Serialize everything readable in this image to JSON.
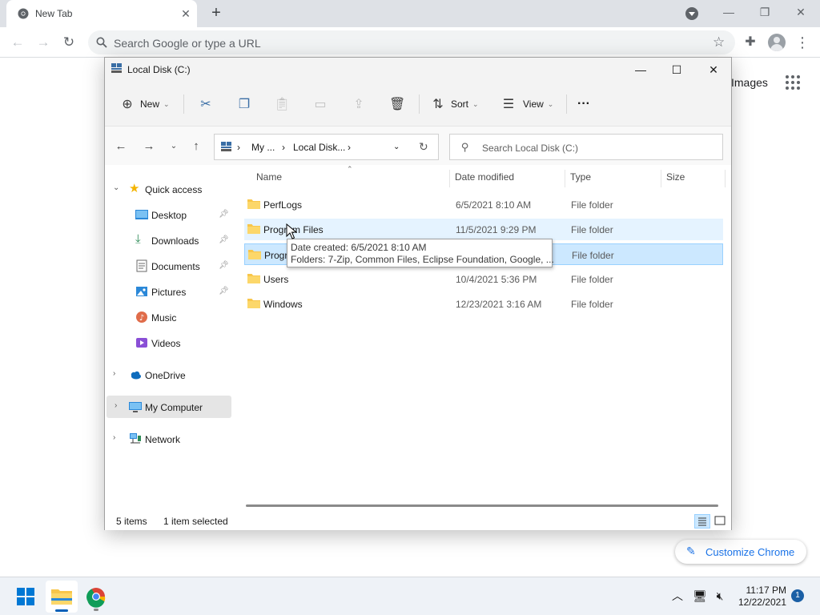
{
  "chrome": {
    "tab_title": "New Tab",
    "tab_close": "✕",
    "new_tab": "+",
    "omnibox_placeholder": "Search Google or type a URL",
    "ntp_images": "Images",
    "customize_label": "Customize Chrome"
  },
  "explorer": {
    "title": "Local Disk (C:)",
    "toolbar": {
      "new_label": "New",
      "sort_label": "Sort",
      "view_label": "View",
      "more_label": "···"
    },
    "breadcrumbs": [
      "My ...",
      "Local Disk..."
    ],
    "search_placeholder": "Search Local Disk (C:)",
    "nav": {
      "quick_access": "Quick access",
      "desktop": "Desktop",
      "downloads": "Downloads",
      "documents": "Documents",
      "pictures": "Pictures",
      "music": "Music",
      "videos": "Videos",
      "onedrive": "OneDrive",
      "my_computer": "My Computer",
      "network": "Network"
    },
    "columns": {
      "name": "Name",
      "date": "Date modified",
      "type": "Type",
      "size": "Size"
    },
    "rows": [
      {
        "name": "PerfLogs",
        "date": "6/5/2021 8:10 AM",
        "type": "File folder"
      },
      {
        "name": "Program Files",
        "date": "11/5/2021 9:29 PM",
        "type": "File folder"
      },
      {
        "name": "Progr",
        "date": "",
        "type": "File folder"
      },
      {
        "name": "Users",
        "date": "10/4/2021 5:36 PM",
        "type": "File folder"
      },
      {
        "name": "Windows",
        "date": "12/23/2021 3:16 AM",
        "type": "File folder"
      }
    ],
    "tooltip": {
      "line1": "Date created: 6/5/2021 8:10 AM",
      "line2": "Folders: 7-Zip, Common Files, Eclipse Foundation, Google, ..."
    },
    "status": {
      "items": "5 items",
      "selected": "1 item selected"
    }
  },
  "taskbar": {
    "time": "11:17 PM",
    "date": "12/22/2021",
    "notifications": "1"
  },
  "colors": {
    "accent": "#005fb8",
    "selection": "#cce8ff",
    "hover": "#e5f3ff",
    "folder": "#f8c64a"
  }
}
